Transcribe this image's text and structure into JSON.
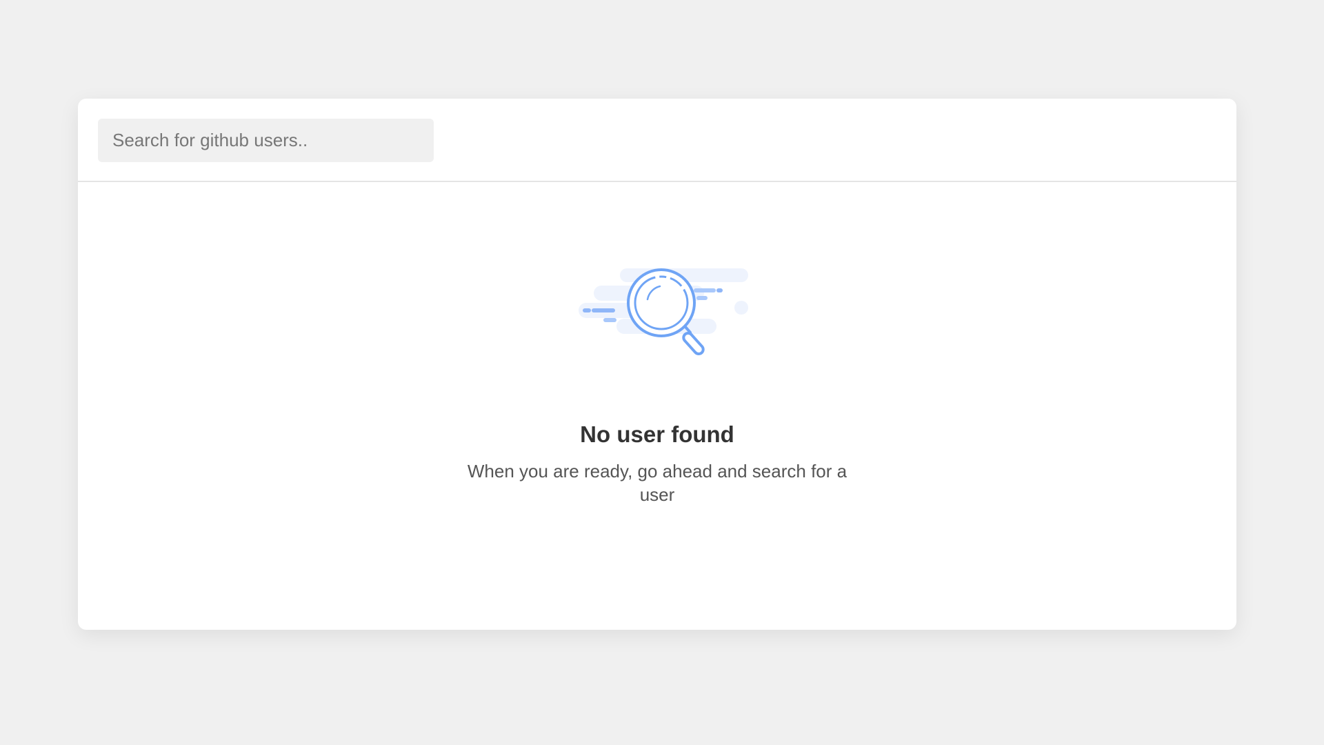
{
  "search": {
    "placeholder": "Search for github users..",
    "value": ""
  },
  "empty_state": {
    "icon": "search-icon",
    "title": "No user found",
    "description": "When you are ready, go ahead and search for a user"
  },
  "colors": {
    "accent": "#6fa4f5",
    "accent_light": "#a9c8fb",
    "cloud": "#eef3fd",
    "background": "#f0f0f0",
    "card": "#ffffff"
  }
}
